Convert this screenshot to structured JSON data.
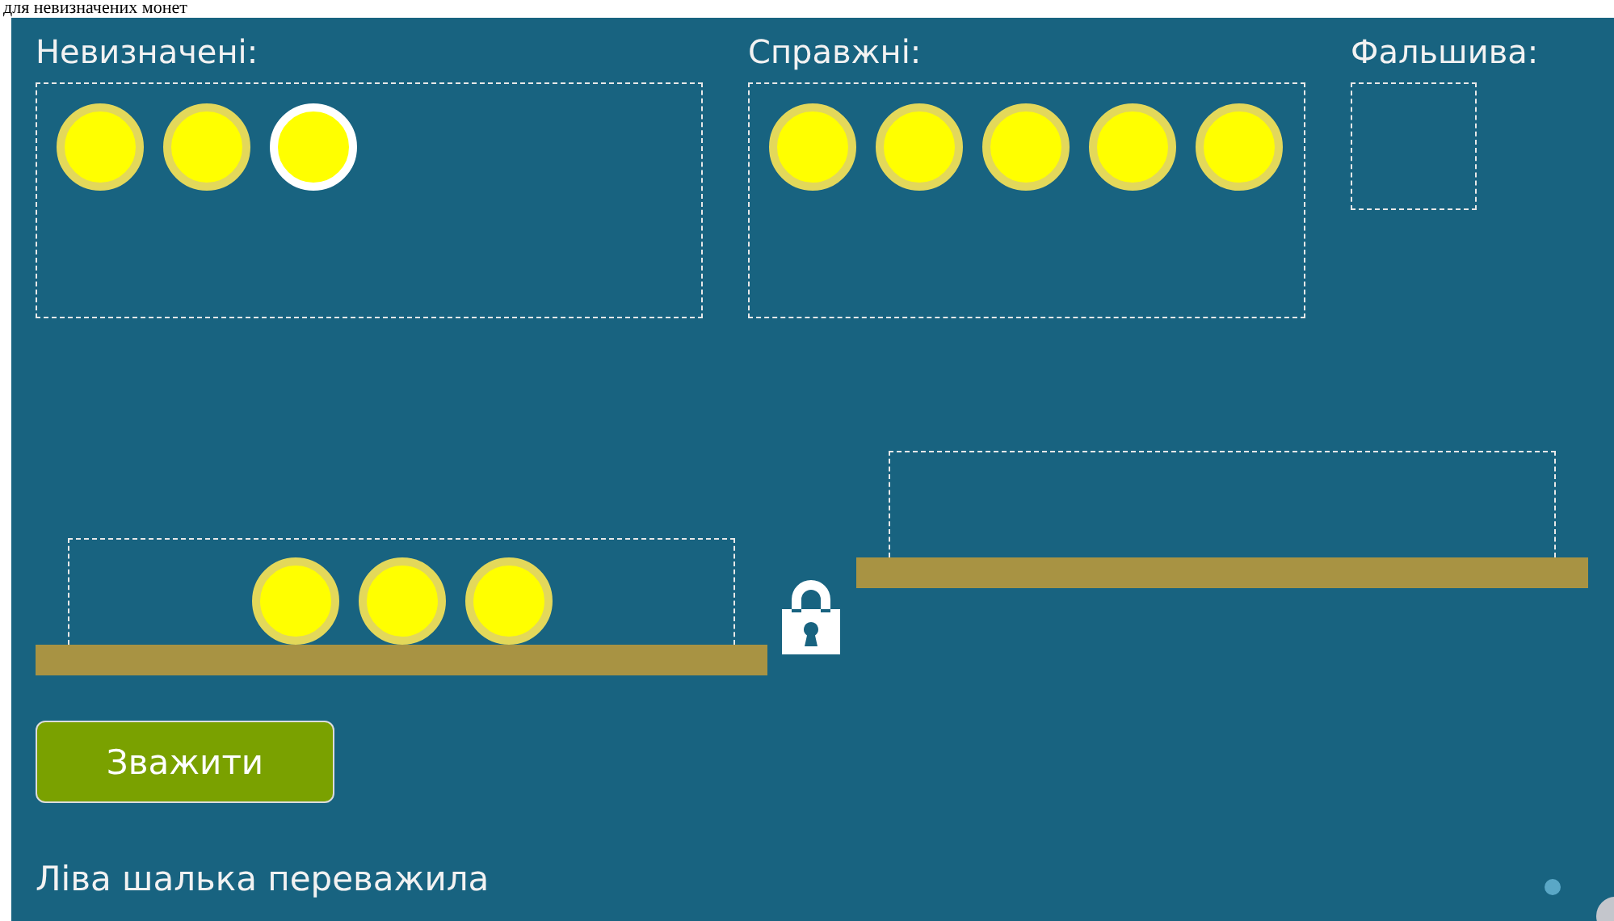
{
  "caption": "для невизначених монет",
  "groups": [
    {
      "kind": "unknown",
      "label": "Невизначені:",
      "coins": [
        {
          "selected": false
        },
        {
          "selected": false
        },
        {
          "selected": true
        }
      ]
    },
    {
      "kind": "genuine",
      "label": "Справжні:",
      "coins": [
        {
          "selected": false
        },
        {
          "selected": false
        },
        {
          "selected": false
        },
        {
          "selected": false
        },
        {
          "selected": false
        }
      ]
    },
    {
      "kind": "fake",
      "label": "Фальшива:"
    }
  ],
  "scale": {
    "locked": true,
    "left_pan": {
      "coins": [
        {
          "selected": false
        },
        {
          "selected": false
        },
        {
          "selected": false
        }
      ]
    }
  },
  "weigh_button": "Зважити",
  "result": "Ліва шалька переважила"
}
